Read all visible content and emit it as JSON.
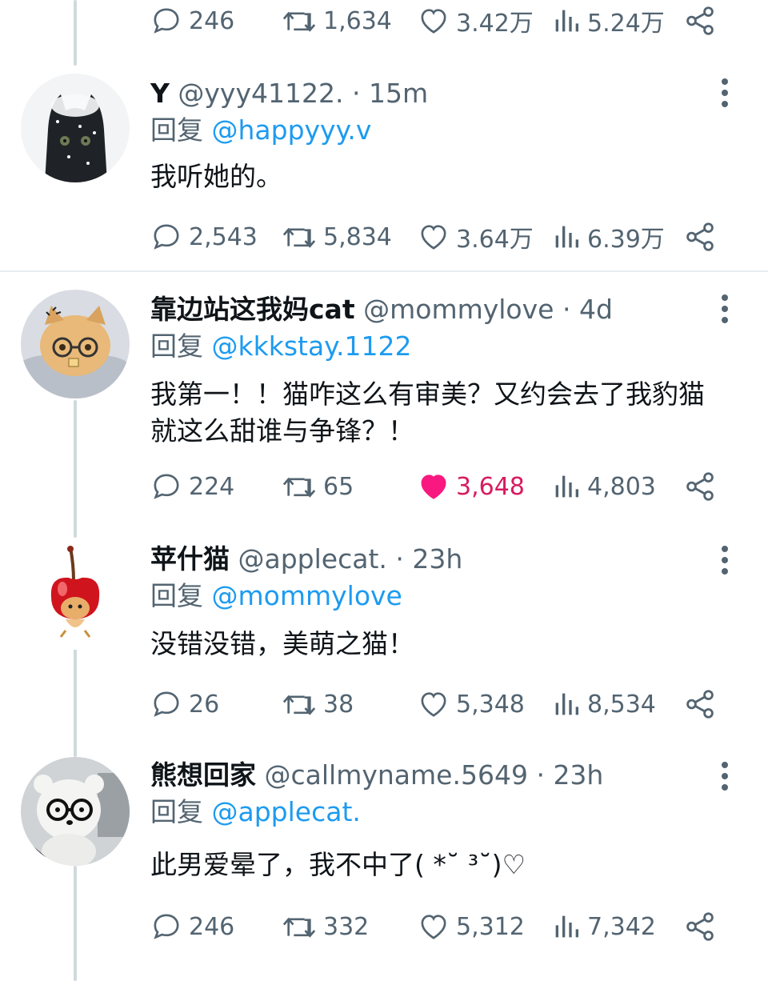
{
  "top_stats": {
    "replies": "246",
    "retweets": "1,634",
    "likes": "3.42万",
    "views": "5.24万"
  },
  "tweets": [
    {
      "name": "Y",
      "handle": "@yyy41122.",
      "time": "15m",
      "reply_prefix": "回复",
      "reply_to": "@happyyy.v",
      "text": "我听她的。",
      "replies": "2,543",
      "retweets": "5,834",
      "likes": "3.64万",
      "views": "6.39万",
      "liked": false
    },
    {
      "name": "靠边站这我妈cat",
      "handle": "@mommylove",
      "time": "4d",
      "reply_prefix": "回复",
      "reply_to": "@kkkstay.1122",
      "text": "我第一！！猫咋这么有审美？又约会去了我豹猫就这么甜谁与争锋？！",
      "replies": "224",
      "retweets": "65",
      "likes": "3,648",
      "views": "4,803",
      "liked": true
    },
    {
      "name": "苹什猫",
      "handle": "@applecat.",
      "time": "23h",
      "reply_prefix": "回复",
      "reply_to": "@mommylove",
      "text": "没错没错，美萌之猫！",
      "replies": "26",
      "retweets": "38",
      "likes": "5,348",
      "views": "8,534",
      "liked": false
    },
    {
      "name": "熊想回家",
      "handle": "@callmyname.5649",
      "time": "23h",
      "reply_prefix": "回复",
      "reply_to": "@applecat.",
      "text": "此男爱晕了，我不中了( *˘ ³˘)♡",
      "replies": "246",
      "retweets": "332",
      "likes": "5,312",
      "views": "7,342",
      "liked": false
    }
  ],
  "colors": {
    "accent": "#1d9bf0",
    "like": "#d81a60",
    "muted": "#536471"
  },
  "icons": [
    "reply-icon",
    "retweet-icon",
    "like-icon",
    "views-icon",
    "share-icon",
    "more-icon"
  ]
}
